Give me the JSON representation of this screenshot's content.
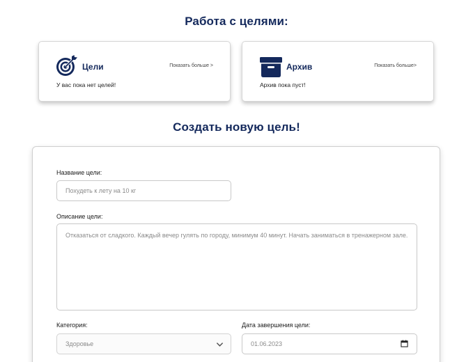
{
  "sections": {
    "work_title": "Работа с целями:",
    "create_title": "Создать новую цель!"
  },
  "cards": {
    "goals": {
      "title": "Цели",
      "more": "Показать больше >",
      "status": "У вас пока нет целей!",
      "icon": "target-icon"
    },
    "archive": {
      "title": "Архив",
      "more": "Показать больше>",
      "status": "Архив пока пуст!",
      "icon": "archive-box-icon"
    }
  },
  "form": {
    "name_label": "Название цели:",
    "name_placeholder": "Похудеть к лету на 10 кг",
    "description_label": "Описание цели:",
    "description_placeholder": "Отказаться от сладкого. Каждый вечер гулять по городу, минимум 40 минут. Начать заниматься в тренажерном зале.",
    "category_label": "Категория:",
    "category_value": "Здоровье",
    "deadline_label": "Дата завершения цели:",
    "deadline_value": "01.06.2023"
  },
  "colors": {
    "accent": "#14295c"
  }
}
